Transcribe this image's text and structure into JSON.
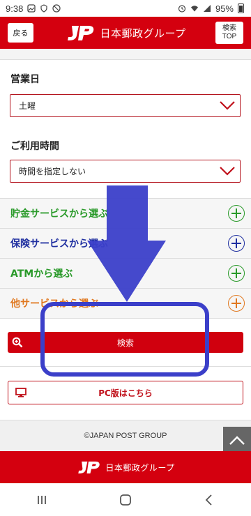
{
  "status_bar": {
    "time": "9:38",
    "battery": "95%"
  },
  "header": {
    "back_label": "戻る",
    "brand": "日本郵政グループ",
    "top_line1": "検索",
    "top_line2": "TOP"
  },
  "form": {
    "business_day_label": "営業日",
    "business_day_value": "土曜",
    "hours_label": "ご利用時間",
    "hours_value": "時間を指定しない"
  },
  "services": [
    {
      "label": "貯金サービスから選ぶ",
      "color": "#2a9a2a"
    },
    {
      "label": "保険サービスから選ぶ",
      "color": "#1f2fa0"
    },
    {
      "label": "ATMから選ぶ",
      "color": "#2a9a2a"
    },
    {
      "label": "他サービスから選ぶ",
      "color": "#e07820"
    }
  ],
  "search_button": "検索",
  "pc_button": "PC版はこちら",
  "copyright": "©JAPAN POST GROUP",
  "footer_brand": "日本郵政グループ",
  "colors": {
    "brand_red": "#d4000f",
    "annotation_blue": "#3b3fc9"
  },
  "icons": {
    "to_top": "chevron-up-icon",
    "search": "zoom-icon",
    "pc": "monitor-icon"
  }
}
